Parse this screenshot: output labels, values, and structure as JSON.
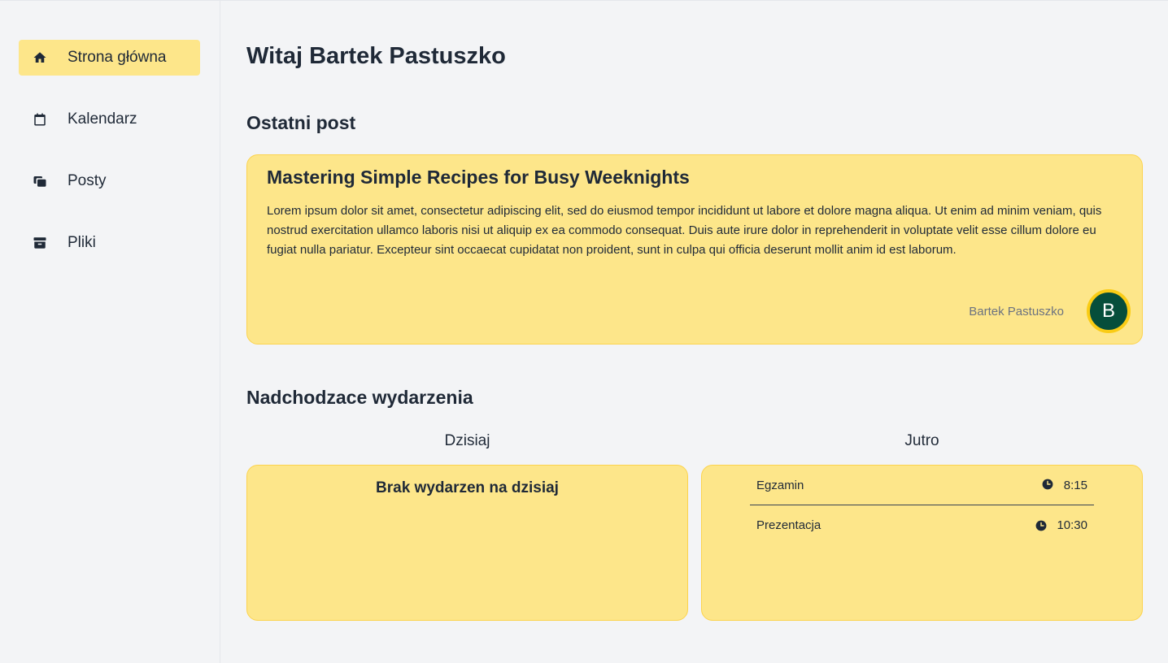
{
  "sidebar": {
    "items": [
      {
        "label": "Strona główna",
        "icon": "home-icon",
        "active": true
      },
      {
        "label": "Kalendarz",
        "icon": "calendar-icon",
        "active": false
      },
      {
        "label": "Posty",
        "icon": "posts-icon",
        "active": false
      },
      {
        "label": "Pliki",
        "icon": "archive-icon",
        "active": false
      }
    ]
  },
  "main": {
    "title": "Witaj Bartek Pastuszko",
    "latest_post_heading": "Ostatni post",
    "post": {
      "title": "Mastering Simple Recipes for Busy Weeknights",
      "body": "Lorem ipsum dolor sit amet, consectetur adipiscing elit, sed do eiusmod tempor incididunt ut labore et dolore magna aliqua. Ut enim ad minim veniam, quis nostrud exercitation ullamco laboris nisi ut aliquip ex ea commodo consequat. Duis aute irure dolor in reprehenderit in voluptate velit esse cillum dolore eu fugiat nulla pariatur. Excepteur sint occaecat cupidatat non proident, sunt in culpa qui officia deserunt mollit anim id est laborum.",
      "author": "Bartek Pastuszko",
      "avatar_letter": "B"
    },
    "events_heading": "Nadchodzace wydarzenia",
    "today": {
      "label": "Dzisiaj",
      "empty_text": "Brak wydarzen na dzisiaj"
    },
    "tomorrow": {
      "label": "Jutro",
      "events": [
        {
          "name": "Egzamin",
          "time": "8:15"
        },
        {
          "name": "Prezentacja",
          "time": "10:30"
        }
      ]
    }
  },
  "colors": {
    "accent": "#fde68a",
    "avatar_bg": "#064e3b",
    "avatar_ring": "#facc15",
    "background": "#f3f4f6"
  }
}
